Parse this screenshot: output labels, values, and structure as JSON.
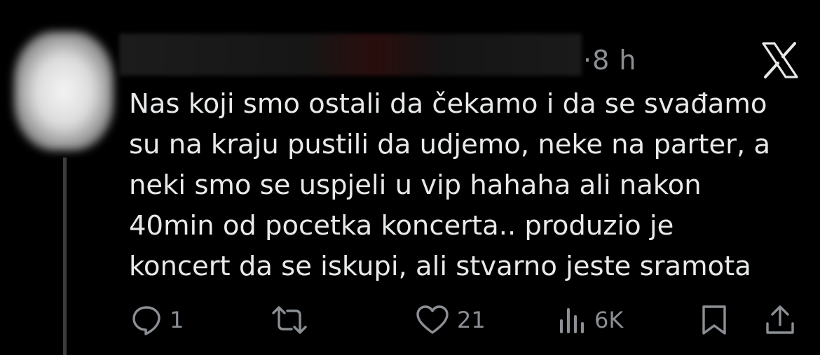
{
  "tweet": {
    "timestamp": "·8 h",
    "text": "Nas koji smo ostali da čekamo i da se svađamo\nsu na kraju pustili da udjemo, neke na parter, a\nneki smo se uspjeli u vip hahaha ali nakon\n40min od pocetka koncerta.. produzio je\nkoncert da se iskupi, ali stvarno jeste sramota"
  },
  "actions": {
    "reply_count": "1",
    "repost_count": "",
    "like_count": "21",
    "views_count": "6K"
  },
  "icons": {
    "brand": "x-logo-icon",
    "reply": "reply-icon",
    "repost": "repost-icon",
    "like": "heart-icon",
    "views": "views-icon",
    "bookmark": "bookmark-icon",
    "share": "share-icon"
  },
  "colors": {
    "background": "#000000",
    "text": "#e7e9ea",
    "muted": "#8b8f94"
  }
}
